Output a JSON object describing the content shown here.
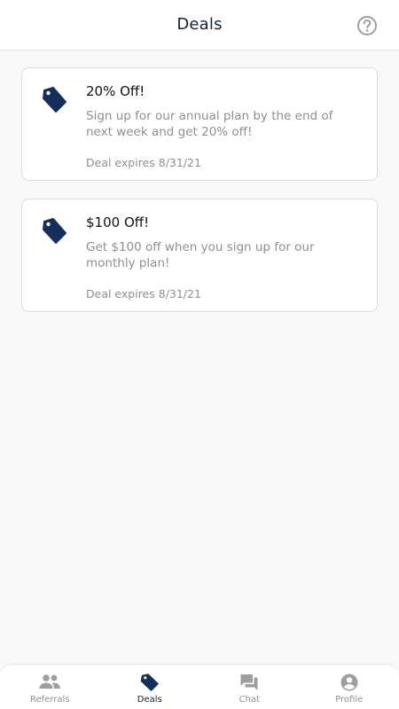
{
  "header": {
    "title": "Deals",
    "help_icon": "help-circle-icon"
  },
  "deals": [
    {
      "title": "20% Off!",
      "description": "Sign up for our annual plan by the end of next week and get 20% off!",
      "expiry": "Deal expires 8/31/21",
      "icon": "tag-icon"
    },
    {
      "title": "$100 Off!",
      "description": "Get $100 off when you sign up for our monthly plan!",
      "expiry": "Deal expires 8/31/21",
      "icon": "tag-icon"
    }
  ],
  "tabbar": {
    "tabs": [
      {
        "label": "Referrals",
        "icon": "people-icon",
        "active": false
      },
      {
        "label": "Deals",
        "icon": "tag-icon",
        "active": true
      },
      {
        "label": "Chat",
        "icon": "chat-icon",
        "active": false
      },
      {
        "label": "Profile",
        "icon": "account-circle-icon",
        "active": false
      }
    ]
  },
  "colors": {
    "primary": "#14213d",
    "tag_icon": "#14305a",
    "muted_text": "#8f8f8f",
    "inactive_icon": "#9e9e9e",
    "background": "#f8f8f8"
  }
}
